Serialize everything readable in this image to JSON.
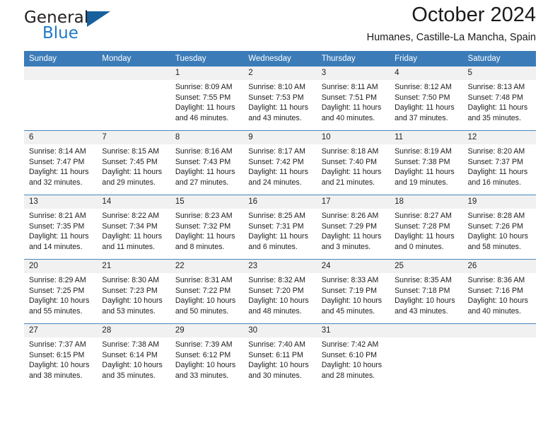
{
  "brand": {
    "name_top": "General",
    "name_bottom": "Blue",
    "colors": {
      "dark": "#231f20",
      "blue": "#2079c7",
      "triangle": "#16609e"
    }
  },
  "header": {
    "title": "October 2024",
    "subtitle": "Humanes, Castille-La Mancha, Spain"
  },
  "theme": {
    "header_row_bg": "#3b7cb8",
    "daynum_bg": "#f1f1f1",
    "week_rule": "#4a87bd"
  },
  "weekday_headers": [
    "Sunday",
    "Monday",
    "Tuesday",
    "Wednesday",
    "Thursday",
    "Friday",
    "Saturday"
  ],
  "labels": {
    "sunrise_prefix": "Sunrise:",
    "sunset_prefix": "Sunset:",
    "daylight_prefix": "Daylight:"
  },
  "weeks": [
    [
      {
        "day": "",
        "empty": true
      },
      {
        "day": "",
        "empty": true
      },
      {
        "day": "1",
        "sunrise": "Sunrise: 8:09 AM",
        "sunset": "Sunset: 7:55 PM",
        "daylight_line1": "Daylight: 11 hours",
        "daylight_line2": "and 46 minutes."
      },
      {
        "day": "2",
        "sunrise": "Sunrise: 8:10 AM",
        "sunset": "Sunset: 7:53 PM",
        "daylight_line1": "Daylight: 11 hours",
        "daylight_line2": "and 43 minutes."
      },
      {
        "day": "3",
        "sunrise": "Sunrise: 8:11 AM",
        "sunset": "Sunset: 7:51 PM",
        "daylight_line1": "Daylight: 11 hours",
        "daylight_line2": "and 40 minutes."
      },
      {
        "day": "4",
        "sunrise": "Sunrise: 8:12 AM",
        "sunset": "Sunset: 7:50 PM",
        "daylight_line1": "Daylight: 11 hours",
        "daylight_line2": "and 37 minutes."
      },
      {
        "day": "5",
        "sunrise": "Sunrise: 8:13 AM",
        "sunset": "Sunset: 7:48 PM",
        "daylight_line1": "Daylight: 11 hours",
        "daylight_line2": "and 35 minutes."
      }
    ],
    [
      {
        "day": "6",
        "sunrise": "Sunrise: 8:14 AM",
        "sunset": "Sunset: 7:47 PM",
        "daylight_line1": "Daylight: 11 hours",
        "daylight_line2": "and 32 minutes."
      },
      {
        "day": "7",
        "sunrise": "Sunrise: 8:15 AM",
        "sunset": "Sunset: 7:45 PM",
        "daylight_line1": "Daylight: 11 hours",
        "daylight_line2": "and 29 minutes."
      },
      {
        "day": "8",
        "sunrise": "Sunrise: 8:16 AM",
        "sunset": "Sunset: 7:43 PM",
        "daylight_line1": "Daylight: 11 hours",
        "daylight_line2": "and 27 minutes."
      },
      {
        "day": "9",
        "sunrise": "Sunrise: 8:17 AM",
        "sunset": "Sunset: 7:42 PM",
        "daylight_line1": "Daylight: 11 hours",
        "daylight_line2": "and 24 minutes."
      },
      {
        "day": "10",
        "sunrise": "Sunrise: 8:18 AM",
        "sunset": "Sunset: 7:40 PM",
        "daylight_line1": "Daylight: 11 hours",
        "daylight_line2": "and 21 minutes."
      },
      {
        "day": "11",
        "sunrise": "Sunrise: 8:19 AM",
        "sunset": "Sunset: 7:38 PM",
        "daylight_line1": "Daylight: 11 hours",
        "daylight_line2": "and 19 minutes."
      },
      {
        "day": "12",
        "sunrise": "Sunrise: 8:20 AM",
        "sunset": "Sunset: 7:37 PM",
        "daylight_line1": "Daylight: 11 hours",
        "daylight_line2": "and 16 minutes."
      }
    ],
    [
      {
        "day": "13",
        "sunrise": "Sunrise: 8:21 AM",
        "sunset": "Sunset: 7:35 PM",
        "daylight_line1": "Daylight: 11 hours",
        "daylight_line2": "and 14 minutes."
      },
      {
        "day": "14",
        "sunrise": "Sunrise: 8:22 AM",
        "sunset": "Sunset: 7:34 PM",
        "daylight_line1": "Daylight: 11 hours",
        "daylight_line2": "and 11 minutes."
      },
      {
        "day": "15",
        "sunrise": "Sunrise: 8:23 AM",
        "sunset": "Sunset: 7:32 PM",
        "daylight_line1": "Daylight: 11 hours",
        "daylight_line2": "and 8 minutes."
      },
      {
        "day": "16",
        "sunrise": "Sunrise: 8:25 AM",
        "sunset": "Sunset: 7:31 PM",
        "daylight_line1": "Daylight: 11 hours",
        "daylight_line2": "and 6 minutes."
      },
      {
        "day": "17",
        "sunrise": "Sunrise: 8:26 AM",
        "sunset": "Sunset: 7:29 PM",
        "daylight_line1": "Daylight: 11 hours",
        "daylight_line2": "and 3 minutes."
      },
      {
        "day": "18",
        "sunrise": "Sunrise: 8:27 AM",
        "sunset": "Sunset: 7:28 PM",
        "daylight_line1": "Daylight: 11 hours",
        "daylight_line2": "and 0 minutes."
      },
      {
        "day": "19",
        "sunrise": "Sunrise: 8:28 AM",
        "sunset": "Sunset: 7:26 PM",
        "daylight_line1": "Daylight: 10 hours",
        "daylight_line2": "and 58 minutes."
      }
    ],
    [
      {
        "day": "20",
        "sunrise": "Sunrise: 8:29 AM",
        "sunset": "Sunset: 7:25 PM",
        "daylight_line1": "Daylight: 10 hours",
        "daylight_line2": "and 55 minutes."
      },
      {
        "day": "21",
        "sunrise": "Sunrise: 8:30 AM",
        "sunset": "Sunset: 7:23 PM",
        "daylight_line1": "Daylight: 10 hours",
        "daylight_line2": "and 53 minutes."
      },
      {
        "day": "22",
        "sunrise": "Sunrise: 8:31 AM",
        "sunset": "Sunset: 7:22 PM",
        "daylight_line1": "Daylight: 10 hours",
        "daylight_line2": "and 50 minutes."
      },
      {
        "day": "23",
        "sunrise": "Sunrise: 8:32 AM",
        "sunset": "Sunset: 7:20 PM",
        "daylight_line1": "Daylight: 10 hours",
        "daylight_line2": "and 48 minutes."
      },
      {
        "day": "24",
        "sunrise": "Sunrise: 8:33 AM",
        "sunset": "Sunset: 7:19 PM",
        "daylight_line1": "Daylight: 10 hours",
        "daylight_line2": "and 45 minutes."
      },
      {
        "day": "25",
        "sunrise": "Sunrise: 8:35 AM",
        "sunset": "Sunset: 7:18 PM",
        "daylight_line1": "Daylight: 10 hours",
        "daylight_line2": "and 43 minutes."
      },
      {
        "day": "26",
        "sunrise": "Sunrise: 8:36 AM",
        "sunset": "Sunset: 7:16 PM",
        "daylight_line1": "Daylight: 10 hours",
        "daylight_line2": "and 40 minutes."
      }
    ],
    [
      {
        "day": "27",
        "sunrise": "Sunrise: 7:37 AM",
        "sunset": "Sunset: 6:15 PM",
        "daylight_line1": "Daylight: 10 hours",
        "daylight_line2": "and 38 minutes."
      },
      {
        "day": "28",
        "sunrise": "Sunrise: 7:38 AM",
        "sunset": "Sunset: 6:14 PM",
        "daylight_line1": "Daylight: 10 hours",
        "daylight_line2": "and 35 minutes."
      },
      {
        "day": "29",
        "sunrise": "Sunrise: 7:39 AM",
        "sunset": "Sunset: 6:12 PM",
        "daylight_line1": "Daylight: 10 hours",
        "daylight_line2": "and 33 minutes."
      },
      {
        "day": "30",
        "sunrise": "Sunrise: 7:40 AM",
        "sunset": "Sunset: 6:11 PM",
        "daylight_line1": "Daylight: 10 hours",
        "daylight_line2": "and 30 minutes."
      },
      {
        "day": "31",
        "sunrise": "Sunrise: 7:42 AM",
        "sunset": "Sunset: 6:10 PM",
        "daylight_line1": "Daylight: 10 hours",
        "daylight_line2": "and 28 minutes."
      },
      {
        "day": "",
        "empty": true
      },
      {
        "day": "",
        "empty": true
      }
    ]
  ]
}
